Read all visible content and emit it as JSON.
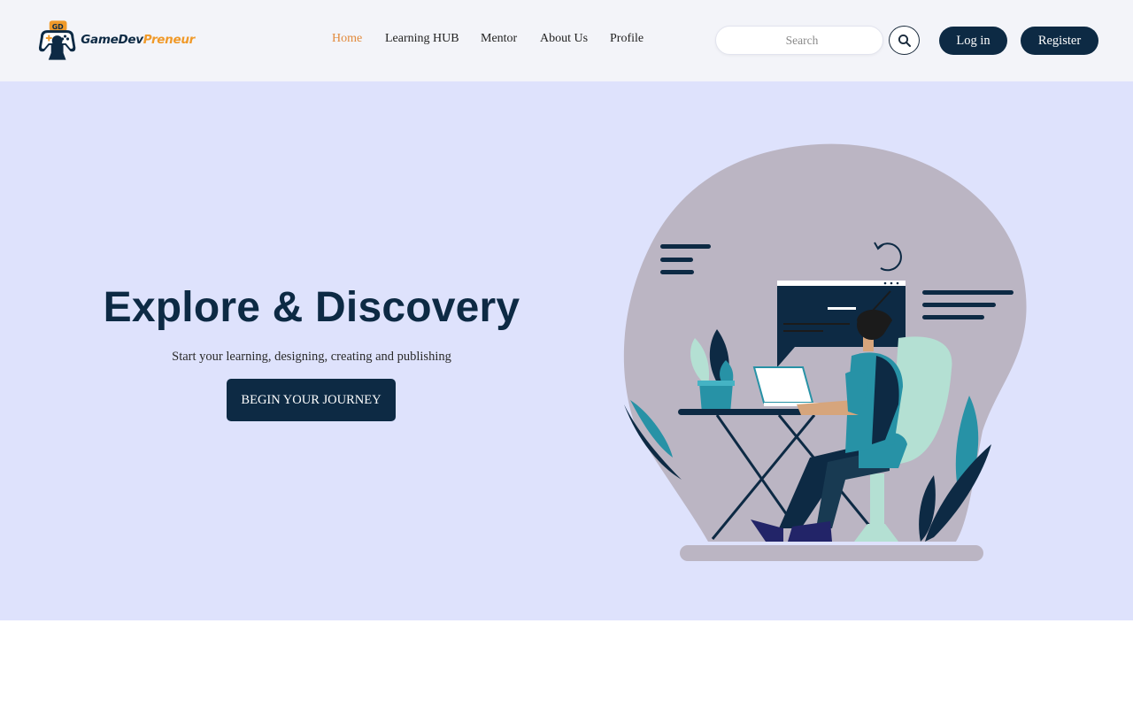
{
  "brand": {
    "name_part1": "GameDev",
    "name_part2": "Preneur",
    "logo_icon": "gamepad-logo-icon"
  },
  "nav": [
    {
      "label": "Home",
      "active": true
    },
    {
      "label": "Learning HUB",
      "active": false
    },
    {
      "label": "Mentor",
      "active": false
    },
    {
      "label": "About Us",
      "active": false
    },
    {
      "label": "Profile",
      "active": false
    }
  ],
  "search": {
    "placeholder": "Search",
    "value": "",
    "icon": "search-icon"
  },
  "auth": {
    "login_label": "Log in",
    "register_label": "Register"
  },
  "hero": {
    "title": "Explore & Discovery",
    "subtitle": "Start your learning, designing, creating and publishing",
    "cta_label": "BEGIN YOUR JOURNEY",
    "illustration": "person-working-on-laptop-illustration"
  },
  "colors": {
    "primary": "#0d2a44",
    "accent": "#e28a3c",
    "hero_bg": "#dee2fc",
    "header_bg": "#f3f4f9",
    "blob": "#bbb5c3",
    "teal": "#2792a6",
    "mint": "#b4e0d3"
  }
}
